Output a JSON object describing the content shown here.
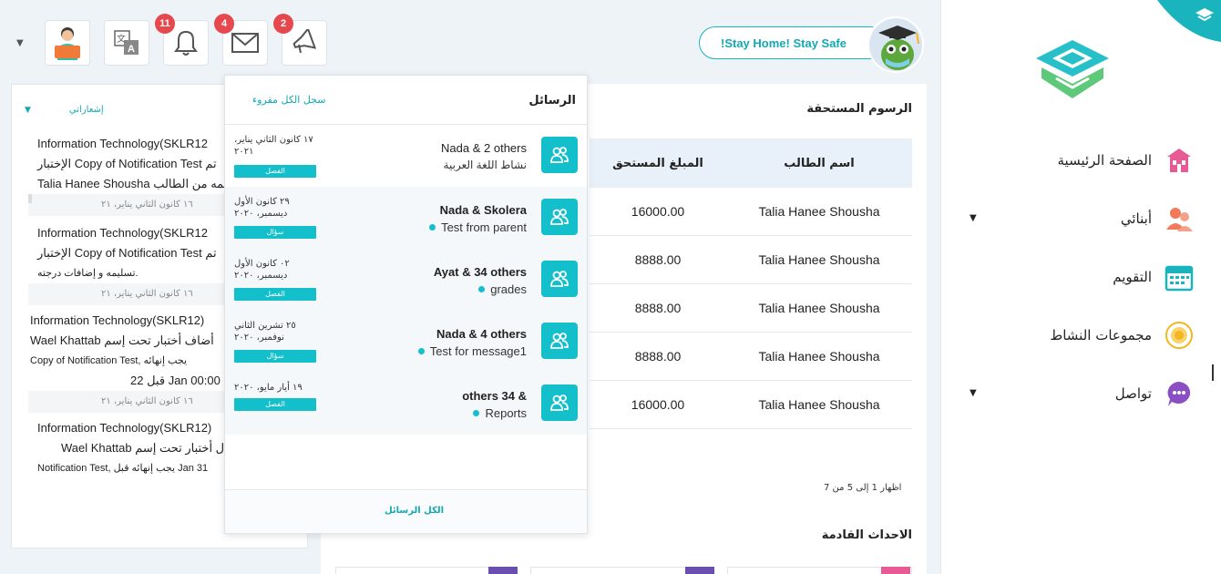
{
  "sidebar": {
    "items": [
      {
        "label": "الصفحة الرئيسية",
        "icon": "home-icon",
        "color": "#e85a95",
        "has_caret": false
      },
      {
        "label": "أبنائي",
        "icon": "children-icon",
        "color": "#f07a5a",
        "has_caret": true
      },
      {
        "label": "التقويم",
        "icon": "calendar-icon",
        "color": "#19b4bd",
        "has_caret": false
      },
      {
        "label": "مجموعات النشاط",
        "icon": "activity-icon",
        "color": "#f5b521",
        "has_caret": false
      },
      {
        "label": "تواصل",
        "icon": "chat-icon",
        "color": "#8a4fc2",
        "has_caret": true
      }
    ]
  },
  "topbar": {
    "stay_home": "!Stay Home! Stay Safe",
    "badges": {
      "notifications": "11",
      "messages": "4",
      "announcements": "2"
    }
  },
  "left_panel": {
    "header": "إشعاراتي",
    "notes": [
      {
        "lines": [
          "Information Technology(SKLR12",
          "الإختبار Copy of Notification Test تم",
          "Talia Hanee Shousha تسليمه من الطالب"
        ],
        "date": "١٦ كانون الثاني يناير، ٢١"
      },
      {
        "lines": [
          "Information Technology(SKLR12",
          "الإختبار Copy of Notification Test تم",
          "تسليمه و إضافات درجته."
        ],
        "date": "١٦ كانون الثاني يناير، ٢١"
      },
      {
        "lines": [
          "Information Technology(SKLR12)",
          "Wael Khattab أضاف أختبار تحت إسم",
          "Copy of Notification Test, يجب إنهائه",
          "قبل 22 Jan 00:00"
        ],
        "date": "١٦ كانون الثاني يناير، ٢١"
      },
      {
        "lines": [
          "Information Technology(SKLR12)",
          "Wael Khattab عدل أختبار تحت إسم",
          "Notification Test, يجب إنهائه قبل Jan 31"
        ],
        "date": ""
      }
    ]
  },
  "fees": {
    "title": "الرسوم المستحقة",
    "columns": {
      "name": "اسم الطالب",
      "amount": "المبلغ المستحق"
    },
    "rows": [
      {
        "name": "Talia Hanee Shousha",
        "amount": "16000.00"
      },
      {
        "name": "Talia Hanee Shousha",
        "amount": "8888.00"
      },
      {
        "name": "Talia Hanee Shousha",
        "amount": "8888.00"
      },
      {
        "name": "Talia Hanee Shousha",
        "amount": "8888.00"
      },
      {
        "name": "Talia Hanee Shousha",
        "amount": "16000.00"
      }
    ],
    "pager": "اظهار 1 إلى 5 من 7"
  },
  "events": {
    "title": "الاحداث القادمة"
  },
  "messages": {
    "title": "الرسائل",
    "mark_all": "سجل الكل مقروء",
    "all_messages": "الكل الرسائل",
    "items": [
      {
        "sender": "Nada & 2 others",
        "bold": false,
        "subject": "نشاط اللغة العربية",
        "dot": false,
        "date": "١٧ كانون الثاني يناير، ٢٠٢١",
        "tag": "الفصل"
      },
      {
        "sender": "Nada & Skolera",
        "bold": true,
        "subject": "Test from parent",
        "dot": true,
        "date": "٢٩ كانون الأول ديسمبر، ٢٠٢٠",
        "tag": "سؤال"
      },
      {
        "sender": "Ayat & 34 others",
        "bold": true,
        "subject": "grades",
        "dot": true,
        "date": "٠٢ كانون الأول ديسمبر، ٢٠٢٠",
        "tag": "الفصل"
      },
      {
        "sender": "Nada & 4 others",
        "bold": true,
        "subject": "Test for message1",
        "dot": true,
        "date": "٢٥ تشرين الثاني نوفمبر، ٢٠٢٠",
        "tag": "سؤال"
      },
      {
        "sender": "others 34 &",
        "bold": true,
        "subject": "Reports",
        "dot": true,
        "date": "١٩ أيار مايو، ٢٠٢٠",
        "tag": "الفصل"
      }
    ]
  },
  "colors": {
    "accent": "#12bfcb",
    "badge": "#e5484d",
    "table_head": "#e8f1f9"
  }
}
